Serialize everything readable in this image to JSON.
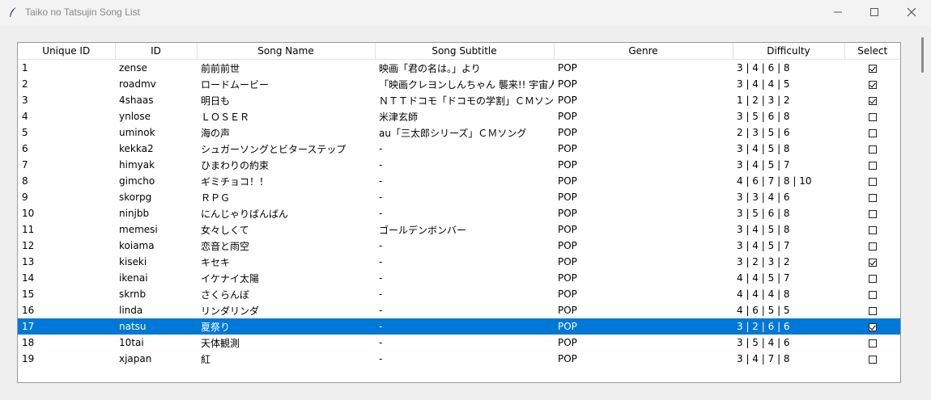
{
  "window": {
    "title": "Taiko no Tatsujin Song List",
    "icons": {
      "app": "feather-icon",
      "minimize": "minimize-icon",
      "maximize": "maximize-icon",
      "close": "close-icon"
    }
  },
  "table": {
    "headers": [
      "Unique ID",
      "ID",
      "Song Name",
      "Song Subtitle",
      "Genre",
      "Difficulty",
      "Select"
    ],
    "selected_row_color": "#0078d7",
    "rows": [
      {
        "uid": "1",
        "id": "zense",
        "name": "前前前世",
        "subtitle": "映画「君の名は。」より",
        "genre": "POP",
        "difficulty": "3 | 4 | 6 | 8",
        "checked": true
      },
      {
        "uid": "2",
        "id": "roadmv",
        "name": "ロードムービー",
        "subtitle": "「映画クレヨンしんちゃん 襲来!! 宇宙人",
        "genre": "POP",
        "difficulty": "3 | 4 | 4 | 5",
        "checked": true
      },
      {
        "uid": "3",
        "id": "4shaas",
        "name": "明日も",
        "subtitle": "ＮＴＴドコモ「ドコモの学割」ＣＭソング",
        "genre": "POP",
        "difficulty": "1 | 2 | 3 | 2",
        "checked": true
      },
      {
        "uid": "4",
        "id": "ynlose",
        "name": "ＬＯＳＥＲ",
        "subtitle": "米津玄師",
        "genre": "POP",
        "difficulty": "3 | 5 | 6 | 8",
        "checked": false
      },
      {
        "uid": "5",
        "id": "uminok",
        "name": "海の声",
        "subtitle": "au「三太郎シリーズ」ＣＭソング",
        "genre": "POP",
        "difficulty": "2 | 3 | 5 | 6",
        "checked": false
      },
      {
        "uid": "6",
        "id": "kekka2",
        "name": "シュガーソングとビターステップ",
        "subtitle": "-",
        "genre": "POP",
        "difficulty": "3 | 4 | 5 | 8",
        "checked": false
      },
      {
        "uid": "7",
        "id": "himyak",
        "name": "ひまわりの約束",
        "subtitle": "-",
        "genre": "POP",
        "difficulty": "3 | 4 | 5 | 7",
        "checked": false
      },
      {
        "uid": "8",
        "id": "gimcho",
        "name": "ギミチョコ！！",
        "subtitle": "-",
        "genre": "POP",
        "difficulty": "4 | 6 | 7 | 8 | 10",
        "checked": false
      },
      {
        "uid": "9",
        "id": "skorpg",
        "name": "ＲＰＧ",
        "subtitle": "-",
        "genre": "POP",
        "difficulty": "3 | 3 | 4 | 6",
        "checked": false
      },
      {
        "uid": "10",
        "id": "ninjbb",
        "name": "にんじゃりばんばん",
        "subtitle": "-",
        "genre": "POP",
        "difficulty": "3 | 5 | 6 | 8",
        "checked": false
      },
      {
        "uid": "11",
        "id": "memesi",
        "name": "女々しくて",
        "subtitle": "ゴールデンボンバー",
        "genre": "POP",
        "difficulty": "3 | 4 | 5 | 8",
        "checked": false
      },
      {
        "uid": "12",
        "id": "koiama",
        "name": "恋音と雨空",
        "subtitle": "-",
        "genre": "POP",
        "difficulty": "3 | 4 | 5 | 7",
        "checked": false
      },
      {
        "uid": "13",
        "id": "kiseki",
        "name": "キセキ",
        "subtitle": "-",
        "genre": "POP",
        "difficulty": "3 | 2 | 3 | 2",
        "checked": true
      },
      {
        "uid": "14",
        "id": "ikenai",
        "name": "イケナイ太陽",
        "subtitle": "-",
        "genre": "POP",
        "difficulty": "4 | 4 | 5 | 7",
        "checked": false
      },
      {
        "uid": "15",
        "id": "skrnb",
        "name": "さくらんぼ",
        "subtitle": "-",
        "genre": "POP",
        "difficulty": "4 | 4 | 4 | 8",
        "checked": false
      },
      {
        "uid": "16",
        "id": "linda",
        "name": "リンダリンダ",
        "subtitle": "-",
        "genre": "POP",
        "difficulty": "4 | 6 | 5 | 5",
        "checked": false
      },
      {
        "uid": "17",
        "id": "natsu",
        "name": "夏祭り",
        "subtitle": "-",
        "genre": "POP",
        "difficulty": "3 | 2 | 6 | 6",
        "checked": true,
        "selected": true
      },
      {
        "uid": "18",
        "id": "10tai",
        "name": "天体観測",
        "subtitle": "-",
        "genre": "POP",
        "difficulty": "3 | 5 | 4 | 6",
        "checked": false
      },
      {
        "uid": "19",
        "id": "xjapan",
        "name": "紅",
        "subtitle": "-",
        "genre": "POP",
        "difficulty": "3 | 4 | 7 | 8",
        "checked": false
      }
    ]
  }
}
